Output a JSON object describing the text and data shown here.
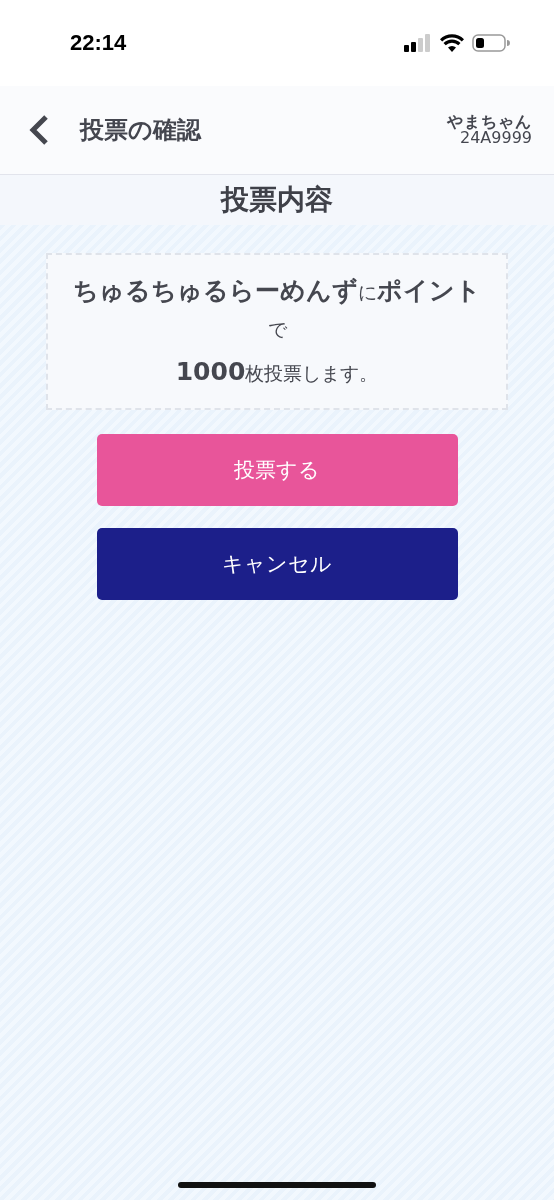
{
  "status_bar": {
    "time": "22:14"
  },
  "header": {
    "title": "投票の確認",
    "user_name": "やまちゃん",
    "user_id": "24A9999"
  },
  "section_title": "投票内容",
  "message": [
    "**ちゅるちゅるらーめんず**に**ポイント**で",
    "**1000**枚投票します。"
  ],
  "buttons": [
    {
      "label": "投票する",
      "kind": "primary"
    },
    {
      "label": "キャンセル",
      "kind": "secondary"
    }
  ]
}
